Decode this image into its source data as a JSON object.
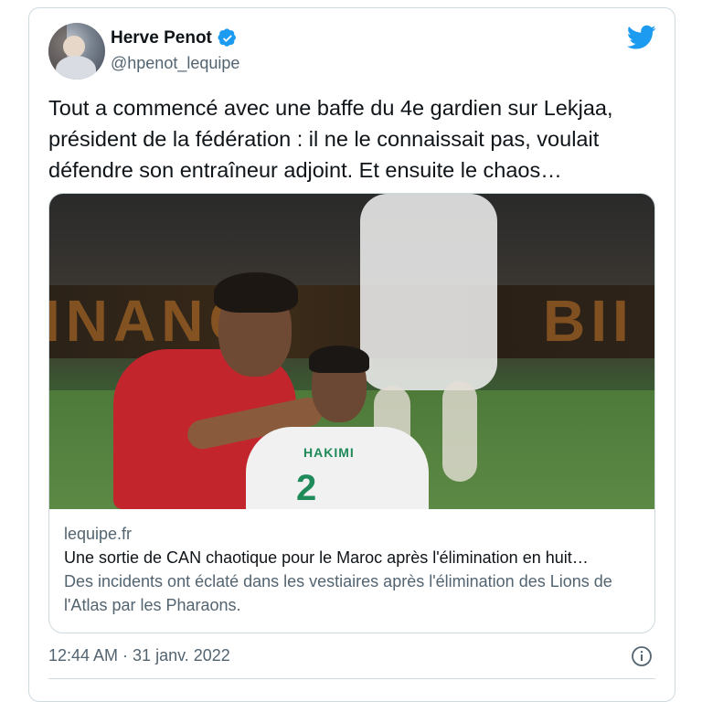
{
  "author": {
    "name": "Herve Penot",
    "handle": "@hpenot_lequipe"
  },
  "tweet": {
    "text": "Tout a commencé avec une baffe du 4e gardien sur Lekjaa, président de la fédération : il ne le connaissait pas, voulait défendre son entraîneur adjoint. Et ensuite le chaos…"
  },
  "link_card": {
    "domain": "lequipe.fr",
    "title": "Une sortie de CAN chaotique pour le Maroc après l'élimination en huit…",
    "description": "Des incidents ont éclaté dans les vestiaires après l'élimination des Lions de l'Atlas par les Pharaons.",
    "image": {
      "jersey_name": "HAKIMI",
      "jersey_number": "2"
    }
  },
  "timestamp": "12:44 AM · 31 janv. 2022",
  "colors": {
    "twitter_blue": "#1d9bf0",
    "text_primary": "#0f1419",
    "text_secondary": "#536471",
    "border": "#cfd9de"
  },
  "icons": {
    "verified": "verified-badge-icon",
    "brand": "twitter-bird-icon",
    "info": "info-icon"
  }
}
